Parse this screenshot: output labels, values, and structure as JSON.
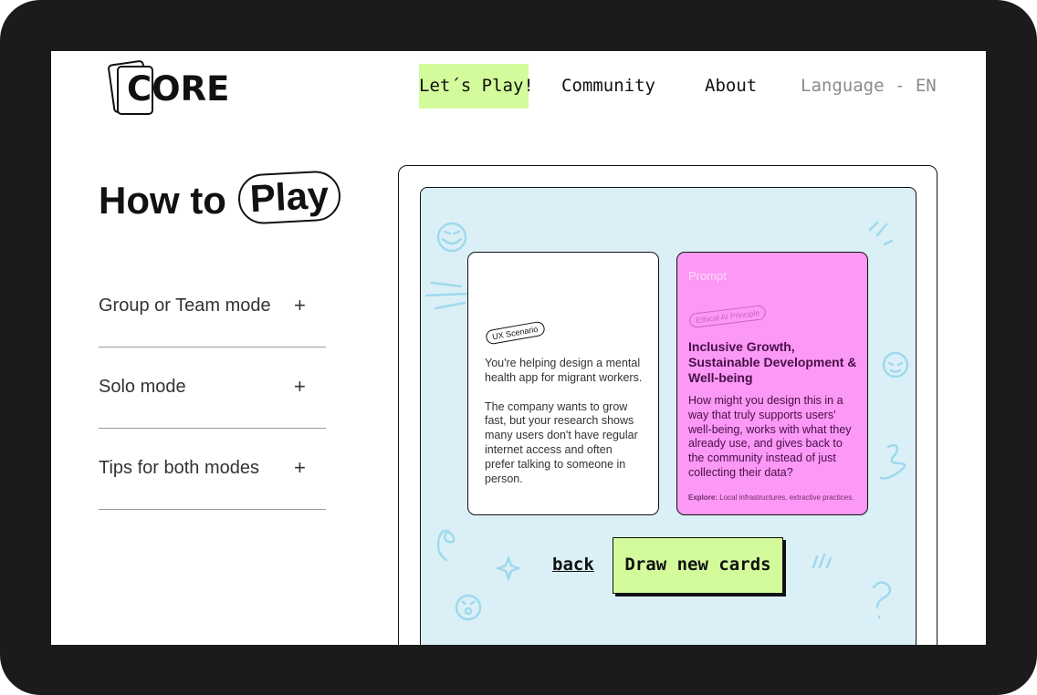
{
  "header": {
    "logo_text": "CORE",
    "nav": {
      "play": "Let´s Play!",
      "community": "Community",
      "about": "About",
      "language": "Language - EN"
    }
  },
  "page": {
    "title_plain": "How to",
    "title_pill": "Play"
  },
  "accordion": [
    {
      "label": "Group or Team mode",
      "icon": "+"
    },
    {
      "label": "Solo mode",
      "icon": "+"
    },
    {
      "label": "Tips for both modes",
      "icon": "+"
    }
  ],
  "ux_card": {
    "tag": "UX Scenario",
    "paragraph_1": "You're helping design a mental health app for migrant workers.",
    "paragraph_2": "The company wants to grow fast, but your research shows many users don't have regular internet access and often prefer talking to someone in person."
  },
  "prompt_card": {
    "label": "Prompt",
    "tag": "Ethical AI Principle",
    "title": "Inclusive Growth, Sustainable Development & Well-being",
    "body": "How might you design this in a way that truly supports users' well-being, works with what they already use, and gives back to the community instead of just collecting their data?",
    "explore_label": "Explore:",
    "explore_text": "Local infrastructures, extractive practices."
  },
  "actions": {
    "back": "back",
    "draw": "Draw new cards"
  },
  "colors": {
    "accent_green": "#d3fb9b",
    "board_blue": "#dbf0f6",
    "prompt_pink": "#fc98f6",
    "doodle_blue": "#9fd9ee"
  }
}
